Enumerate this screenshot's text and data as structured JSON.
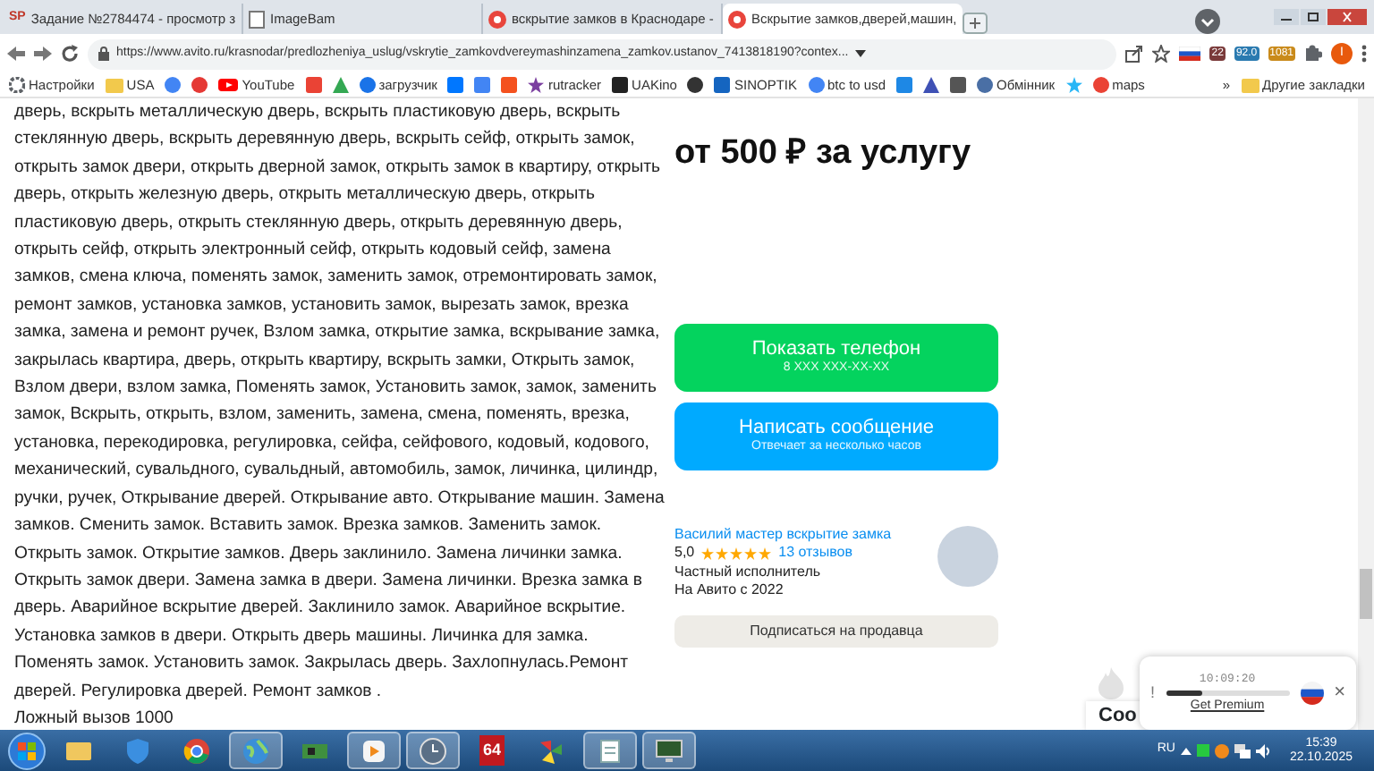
{
  "browser": {
    "tabs": [
      {
        "title": "Задание №2784474 - просмотр з",
        "kind": "letters",
        "favicon_text": "SP",
        "selected": false
      },
      {
        "title": "ImageBam",
        "kind": "page",
        "selected": false
      },
      {
        "title": "вскрытие замков в Краснодаре -",
        "kind": "record",
        "selected": false
      },
      {
        "title": "Вскрытие замков,дверей,машин,",
        "kind": "record",
        "selected": true
      }
    ],
    "address": "https://www.avito.ru/krasnodar/predlozheniya_uslug/vskrytie_zamkovdvereymashinzamena_zamkov.ustanov_7413818190?contex...",
    "extension_badges": [
      "22",
      "92.0",
      "1081"
    ],
    "profile_initial": "I",
    "bookmarks": [
      {
        "kind": "gear",
        "color": "#5f6368",
        "label": "Настройки"
      },
      {
        "kind": "folder",
        "color": "#f2c94c",
        "label": "USA"
      },
      {
        "kind": "circle",
        "color": "#4285f4"
      },
      {
        "kind": "circle",
        "color": "#e53935"
      },
      {
        "kind": "play",
        "color": "#ff0000",
        "label": "YouTube"
      },
      {
        "kind": "square",
        "color": "#ea4335"
      },
      {
        "kind": "triangle",
        "color": "#34a853"
      },
      {
        "kind": "circle",
        "color": "#1a73e8",
        "label": "загрузчик"
      },
      {
        "kind": "square",
        "color": "#0077ff"
      },
      {
        "kind": "square",
        "color": "#4285f4"
      },
      {
        "kind": "square",
        "color": "#f4511e"
      },
      {
        "kind": "star",
        "color": "#7b3fa0",
        "label": "rutracker"
      },
      {
        "kind": "square",
        "color": "#222222",
        "label": "UAKino"
      },
      {
        "kind": "circle",
        "color": "#333333"
      },
      {
        "kind": "square",
        "color": "#1565c0",
        "label": "SINOPTIK"
      },
      {
        "kind": "circle",
        "color": "#4285f4",
        "label": "btc to usd"
      },
      {
        "kind": "square",
        "color": "#1e88e5"
      },
      {
        "kind": "triangle",
        "color": "#3f51b5"
      },
      {
        "kind": "square",
        "color": "#555555"
      },
      {
        "kind": "circle",
        "color": "#4a6fa5",
        "label": "Обмінник"
      },
      {
        "kind": "star",
        "color": "#29b6f6"
      },
      {
        "kind": "circle",
        "color": "#ea4335",
        "label": "maps"
      }
    ],
    "more": "»",
    "other_bookmarks": "Другие закладки"
  },
  "page": {
    "description_top": "дверь, вскрыть металлическую дверь, вскрыть пластиковую дверь, вскрыть",
    "description": "стеклянную дверь, вскрыть деревянную дверь, вскрыть сейф, открыть замок, открыть замок двери, открыть дверной замок, открыть замок в квартиру, открыть дверь, открыть железную дверь, открыть металлическую дверь, открыть пластиковую дверь, открыть стеклянную дверь, открыть деревянную дверь, открыть сейф, открыть электронный сейф, открыть кодовый сейф, замена замков, смена ключа, поменять замок, заменить замок, отремонтировать замок, ремонт замков, установка замков, установить замок, вырезать замок, врезка замка, замена и ремонт ручек, Взлом замка, открытие замка, вскрывание замка, закрылась квартира, дверь, открыть квартиру, вскрыть замки, Открыть замок, Взлом двери, взлом замка, Поменять замок, Установить замок, замок, заменить замок, Вскрыть, открыть, взлом, заменить, замена, смена, поменять, врезка, установка, перекодировка, регулировка, сейфа, сейфового, кодовый, кодового, механический, сувальдного, сувальдный, автомобиль, замок, личинка, цилиндр, ручки, ручек, Открывание дверей. Открывание авто. Открывание машин. Замена замков. Сменить замок. Вставить замок. Врезка замков. Заменить замок. Открыть замок. Открытие замков. Дверь заклинило. Замена личинки замка. Открыть замок двери. Замена замка в двери. Замена личинки. Врезка замка в дверь. Аварийное вскрытие дверей. Заклинило замок. Аварийное вскрытие. Установка замков в двери. Открыть дверь машины. Личинка для замка. Поменять замок. Установить замок. Закрылась дверь. Захлопнулась.Ремонт дверей. Регулировка дверей. Ремонт замков .",
    "footer_note": "Ложный вызов 1000",
    "price": "от 500 ₽ за услугу",
    "phone_button": {
      "label": "Показать телефон",
      "sublabel": "8 XXX XXX-XX-XX"
    },
    "message_button": {
      "label": "Написать сообщение",
      "sublabel": "Отвечает за несколько часов"
    },
    "seller": {
      "name": "Василий мастер вскрытие замка",
      "rating": "5,0",
      "stars": 5,
      "reviews": "13 отзывов",
      "type": "Частный исполнитель",
      "since": "На Авито с 2022"
    },
    "subscribe": "Подписаться на продавца",
    "cookie_text": "Coo"
  },
  "widget": {
    "alert": "!",
    "time": "10:09:20",
    "level": 0.3,
    "link": "Get Premium",
    "close": "×"
  },
  "taskbar": {
    "apps": [
      {
        "kind": "folder",
        "running": false
      },
      {
        "kind": "shield",
        "running": false
      },
      {
        "kind": "browser",
        "running": false
      },
      {
        "kind": "globe",
        "running": true
      },
      {
        "kind": "board",
        "running": false
      },
      {
        "kind": "player",
        "running": true
      },
      {
        "kind": "clock",
        "running": true
      },
      {
        "kind": "tile",
        "label": "64",
        "running": false
      },
      {
        "kind": "pinwheel",
        "running": false
      },
      {
        "kind": "notepad",
        "running": true
      },
      {
        "kind": "monitor",
        "running": true
      }
    ],
    "language": "RU",
    "time": "15:39",
    "date": "22.10.2025"
  }
}
